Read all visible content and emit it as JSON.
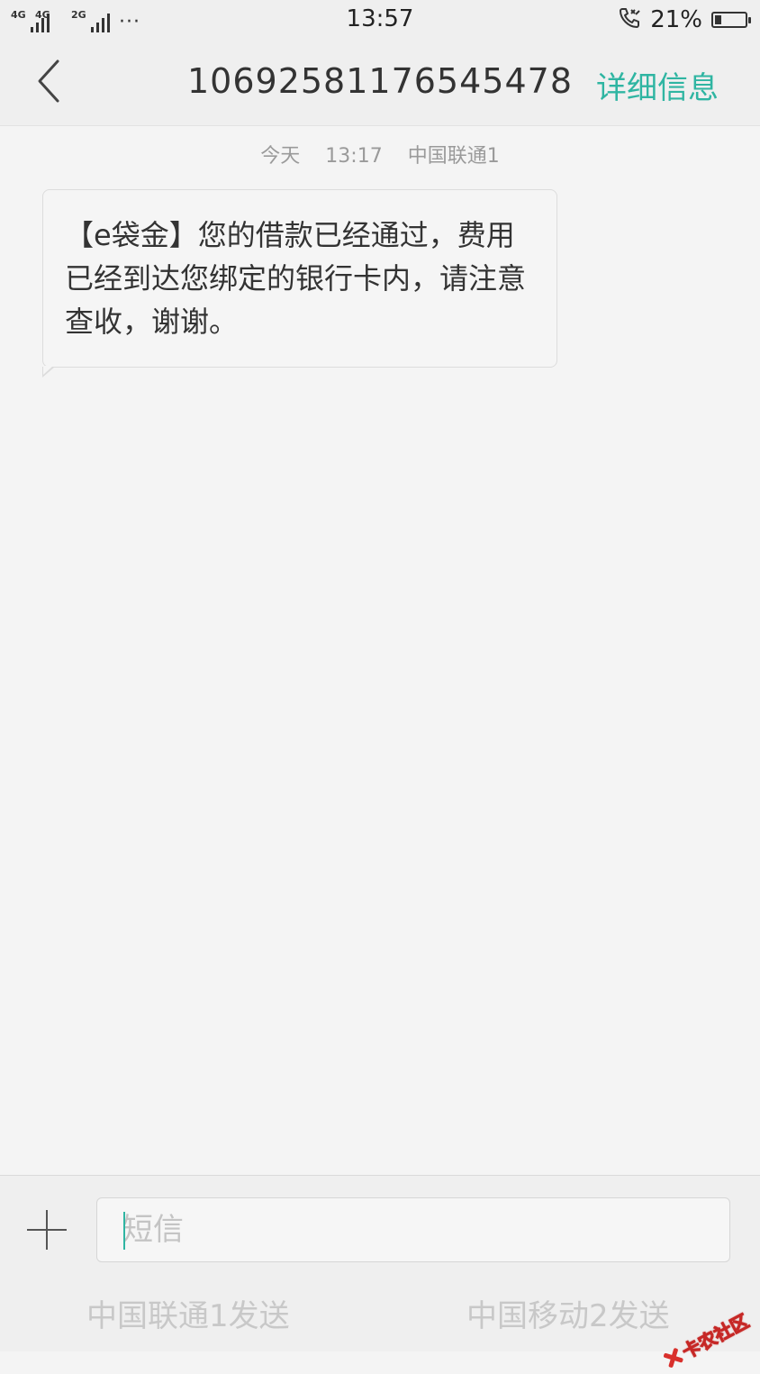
{
  "status_bar": {
    "network_1": "4G",
    "network_2": "4G",
    "network_3": "2G",
    "more": "···",
    "time": "13:57",
    "battery_percent": "21%",
    "battery_level": 0.21,
    "icons": [
      "signal-icon",
      "call-icon",
      "battery-icon"
    ]
  },
  "header": {
    "contact_number": "10692581176545478",
    "details_label": "详细信息",
    "accent_color": "#2fb5a2"
  },
  "conversation": {
    "timestamp_day": "今天",
    "timestamp_time": "13:17",
    "timestamp_sim": "中国联通1",
    "messages": [
      {
        "text": "【e袋金】您的借款已经通过，费用已经到达您绑定的银行卡内，请注意查收，谢谢。"
      }
    ]
  },
  "composer": {
    "placeholder": "短信",
    "value": "",
    "send_sim1_label": "中国联通1发送",
    "send_sim2_label": "中国移动2发送"
  },
  "watermark": {
    "text": "卡农社区"
  }
}
